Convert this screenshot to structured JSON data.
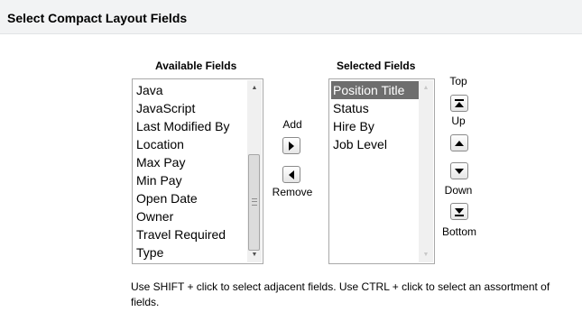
{
  "header": {
    "title": "Select Compact Layout Fields"
  },
  "available": {
    "label": "Available Fields",
    "items": [
      "Java",
      "JavaScript",
      "Last Modified By",
      "Location",
      "Max Pay",
      "Min Pay",
      "Open Date",
      "Owner",
      "Travel Required",
      "Type"
    ]
  },
  "add_remove": {
    "add_label": "Add",
    "remove_label": "Remove"
  },
  "selected": {
    "label": "Selected Fields",
    "items": [
      "Position Title",
      "Status",
      "Hire By",
      "Job Level"
    ],
    "highlighted": "Position Title"
  },
  "ordering": {
    "top_label": "Top",
    "up_label": "Up",
    "down_label": "Down",
    "bottom_label": "Bottom"
  },
  "help_text": "Use SHIFT + click to select adjacent fields. Use CTRL + click to select an assortment of fields.",
  "colors": {
    "header_bg": "#f2f3f4",
    "selection_bg": "#6e6e6e",
    "border": "#a9a9a9"
  }
}
